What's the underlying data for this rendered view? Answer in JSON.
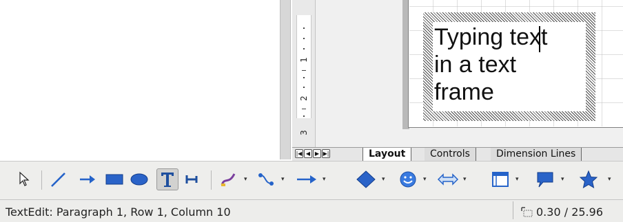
{
  "slide": {
    "text_lines": "Typing text\nin a text\nframe"
  },
  "ruler": {
    "numbers": [
      "1",
      "2",
      "3"
    ]
  },
  "tabs": [
    {
      "label": "Layout",
      "active": true
    },
    {
      "label": "Controls",
      "active": false
    },
    {
      "label": "Dimension Lines",
      "active": false
    }
  ],
  "toolbar": {
    "tools": [
      "select-icon",
      "line-icon",
      "arrow-line-icon",
      "rectangle-icon",
      "ellipse-icon",
      "text-icon",
      "vertical-text-icon",
      "curve-icon",
      "connector-icon",
      "lines-arrows-icon",
      "basic-shapes-icon",
      "symbol-shapes-icon",
      "block-arrows-icon",
      "flowchart-icon",
      "callouts-icon",
      "stars-icon"
    ],
    "active_tool": "text-icon",
    "colors": {
      "blue": "#2563c9",
      "accent_yellow": "#e8b830"
    }
  },
  "status": {
    "text": "TextEdit: Paragraph 1, Row 1, Column 10",
    "position": "0.30 / 25.96"
  }
}
